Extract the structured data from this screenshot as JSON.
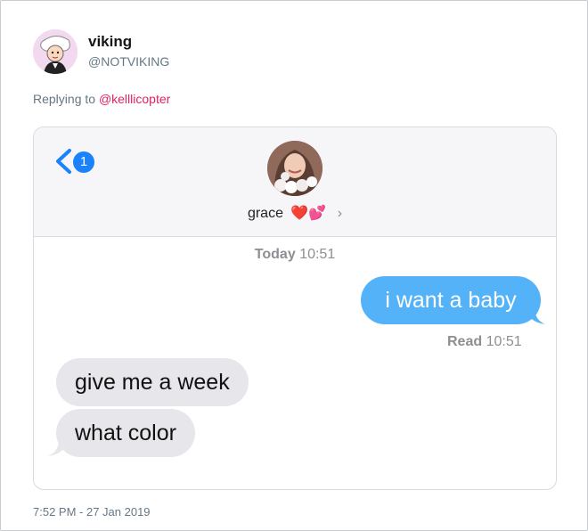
{
  "tweet": {
    "display_name": "viking",
    "handle": "@NOTVIKING",
    "replying_prefix": "Replying to ",
    "replying_to": "@kelllicopter",
    "timestamp": "7:52 PM - 27 Jan 2019"
  },
  "imessage": {
    "back_badge": "1",
    "contact_name": "grace",
    "contact_emoji": "❤️💕",
    "day_label": "Today",
    "day_time": "10:51",
    "messages": [
      {
        "direction": "outgoing",
        "text": "i want a baby"
      },
      {
        "direction": "incoming",
        "text": "give me a week"
      },
      {
        "direction": "incoming",
        "text": "what color"
      }
    ],
    "read_label": "Read",
    "read_time": "10:51"
  },
  "colors": {
    "outgoing_bubble": "#54b2f8",
    "incoming_bubble": "#e6e6eb",
    "badge": "#1a82fb",
    "mention": "#e0245e"
  }
}
